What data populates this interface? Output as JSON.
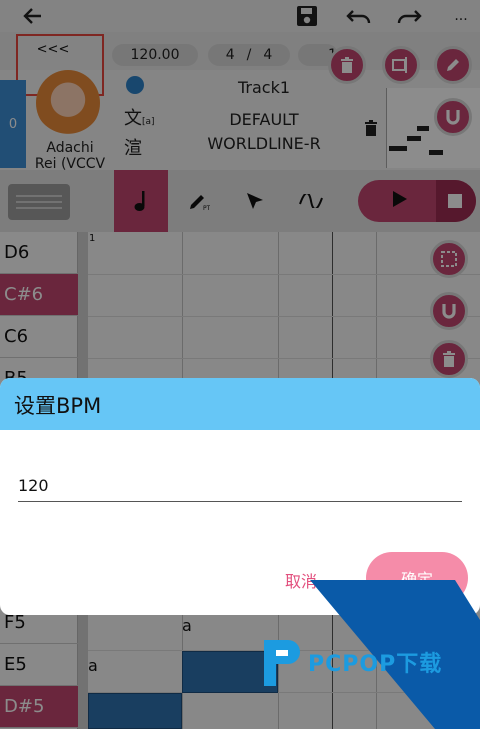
{
  "topbar": {
    "icons": [
      "back-arrow-icon",
      "save-icon",
      "undo-icon",
      "redo-icon",
      "more-icon"
    ],
    "more_glyph": "..."
  },
  "infobar": {
    "back_label": "<<<",
    "bpm": "120.00",
    "time_sig_num": "4",
    "time_sig_sep": "/",
    "time_sig_den": "4",
    "bar_pos": "1"
  },
  "track": {
    "index": "0",
    "singer_name_line1": "Adachi",
    "singer_name_line2": "Rei (VCCV",
    "name": "Track1",
    "phonemizer": "DEFAULT",
    "renderer": "WORLDLINE-R",
    "icon_lyric": "文",
    "icon_render": "渲",
    "icon_lyric_sub": "[a]"
  },
  "piano_keys": [
    "D6",
    "C#6",
    "C6",
    "B5",
    "F5",
    "E5",
    "D#5"
  ],
  "ruler": {
    "bar1": "1"
  },
  "lyrics": [
    "a",
    "a"
  ],
  "dialog": {
    "title": "设置BPM",
    "input_value": "120",
    "cancel_label": "取消",
    "ok_label": "确定"
  },
  "watermark": {
    "text": "PCPOP下载"
  },
  "colors": {
    "accent_pink": "#c2466f",
    "dialog_header": "#66c6f6",
    "ok_button": "#f58ca9",
    "cancel_text": "#e2507e",
    "note_blue": "#2f72b0",
    "highlight_box": "#e8483f"
  }
}
